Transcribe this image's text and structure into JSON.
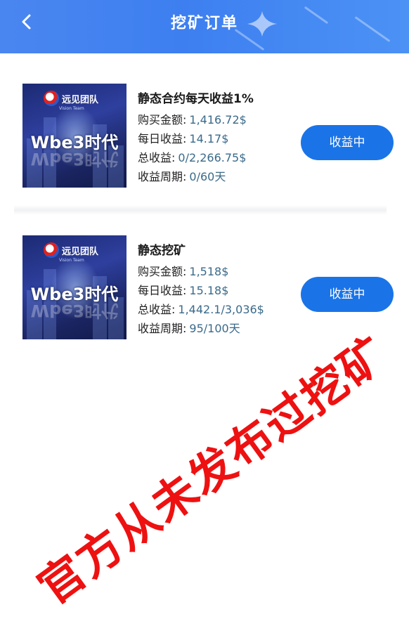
{
  "header": {
    "title": "挖矿订单",
    "back_icon": "chevron-left-icon",
    "bg_color": "#4a86f0"
  },
  "thumbnail": {
    "team_name": "远见团队",
    "team_sub": "Vision Team",
    "brand": "Wbe3时代"
  },
  "orders": [
    {
      "name": "静态合约每天收益1%",
      "purchase_label": "购买金额:",
      "purchase_value": "1,416.72$",
      "daily_label": "每日收益:",
      "daily_value": "14.17$",
      "total_label": "总收益:",
      "total_value": "0/2,266.75$",
      "period_label": "收益周期:",
      "period_value": "0/60天",
      "status_button": "收益中"
    },
    {
      "name": "静态挖矿",
      "purchase_label": "购买金额:",
      "purchase_value": "1,518$",
      "daily_label": "每日收益:",
      "daily_value": "15.18$",
      "total_label": "总收益:",
      "total_value": "1,442.1/3,036$",
      "period_label": "收益周期:",
      "period_value": "95/100天",
      "status_button": "收益中"
    }
  ],
  "watermark": "官方从未发布过挖矿",
  "colors": {
    "button": "#1a74e8",
    "value_text": "#3a6a8a",
    "watermark": "#ee1111"
  }
}
